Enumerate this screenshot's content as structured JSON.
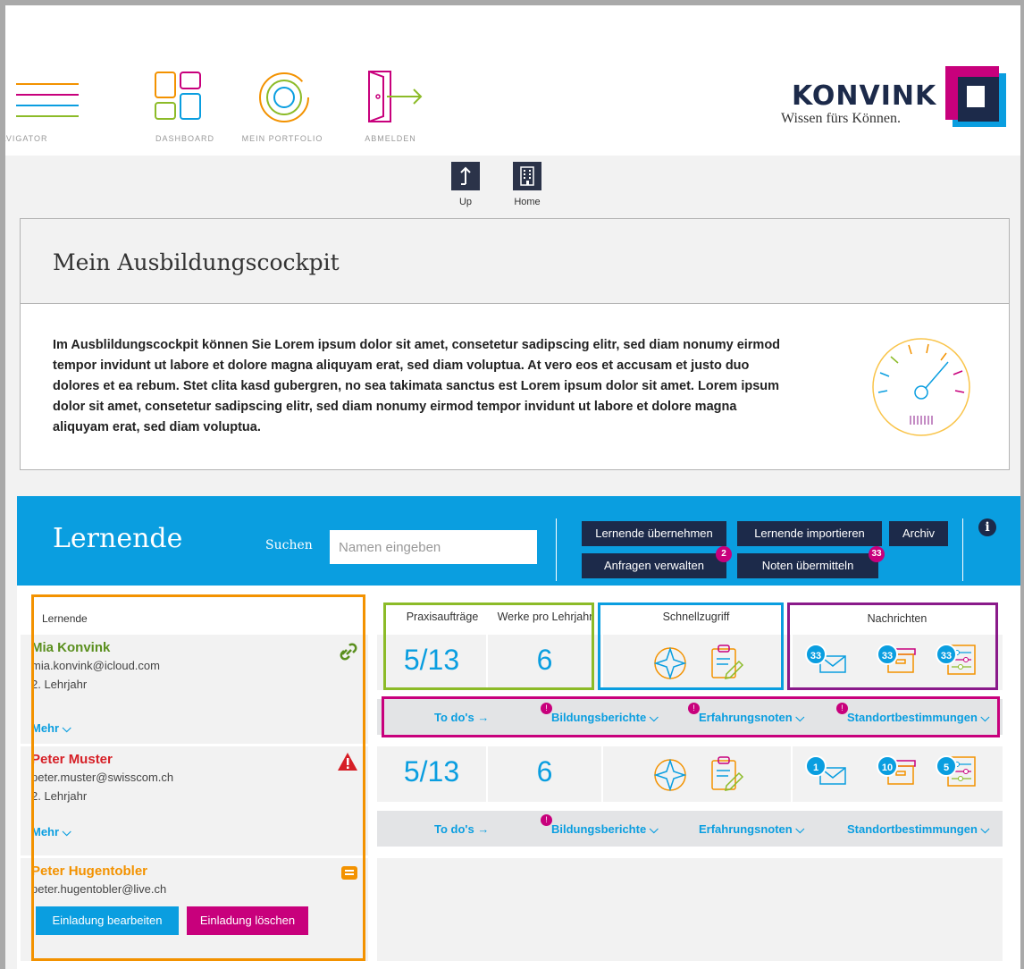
{
  "nav": {
    "items": [
      {
        "label": "NAVIGATOR",
        "icon": "hamburger-icon"
      },
      {
        "label": "DASHBOARD",
        "icon": "dashboard-icon"
      },
      {
        "label": "MEIN PORTFOLIO",
        "icon": "portfolio-icon"
      },
      {
        "label": "ABMELDEN",
        "icon": "logout-icon"
      }
    ]
  },
  "logo": {
    "brand": "KONVINK",
    "tagline": "Wissen fürs Können."
  },
  "subnav": {
    "up_label": "Up",
    "home_label": "Home"
  },
  "cockpit": {
    "title": "Mein Ausbildungscockpit",
    "text": "Im Ausblildungscockpit können Sie Lorem ipsum dolor sit amet, consetetur sadipscing elitr, sed diam nonumy eirmod tempor invidunt ut labore et dolore magna aliquyam erat, sed diam voluptua. At vero eos et accusam et justo duo dolores et ea rebum. Stet clita kasd gubergren, no sea takimata sanctus est Lorem ipsum dolor sit amet. Lorem ipsum dolor sit amet, consetetur sadipscing elitr, sed diam nonumy eirmod tempor invidunt ut labore et dolore magna aliquyam erat, sed diam voluptua."
  },
  "lernende": {
    "title": "Lernende",
    "search_label": "Suchen",
    "search_placeholder": "Namen eingeben",
    "buttons": {
      "uebernehmen": "Lernende übernehmen",
      "importieren": "Lernende importieren",
      "archiv": "Archiv",
      "anfragen": "Anfragen verwalten",
      "anfragen_badge": "2",
      "noten": "Noten übermitteln",
      "noten_badge": "33"
    },
    "col_header": "Lernende",
    "headers": {
      "praxis": "Praxisaufträge",
      "werke": "Werke pro Lehrjahr",
      "schnell": "Schnellzugriff",
      "nachrichten": "Nachrichten"
    },
    "learners": [
      {
        "name": "Mia Konvink",
        "email": "mia.konvink@icloud.com",
        "year": "2. Lehrjahr",
        "more": "Mehr",
        "praxis": "5/13",
        "werke": "6",
        "badges": [
          "33",
          "33",
          "33"
        ],
        "todo": "To do's →",
        "bildung": "Bildungsberichte",
        "erfahrung": "Erfahrungsnoten",
        "standort": "Standortbestimmungen",
        "status_icon": "link-icon",
        "name_color": "#5a8f1e"
      },
      {
        "name": "Peter Muster",
        "email": "peter.muster@swisscom.ch",
        "year": "2. Lehrjahr",
        "more": "Mehr",
        "praxis": "5/13",
        "werke": "6",
        "badges": [
          "1",
          "10",
          "5"
        ],
        "todo": "To do's →",
        "bildung": "Bildungsberichte",
        "erfahrung": "Erfahrungsnoten",
        "standort": "Standortbestimmungen",
        "status_icon": "warning-icon",
        "name_color": "#d61f26"
      },
      {
        "name": "Peter Hugentobler",
        "email": "peter.hugentobler@live.ch",
        "edit_invite": "Einladung bearbeiten",
        "delete_invite": "Einladung löschen",
        "status_icon": "invitation-icon",
        "name_color": "#f39200"
      }
    ],
    "alert_dot": "!"
  },
  "colors": {
    "accent": "#0a9ee0",
    "navy": "#1c2a4a",
    "magenta": "#c8007c",
    "orange": "#f39200",
    "green": "#8cbb28",
    "purple": "#8a1a8a"
  }
}
